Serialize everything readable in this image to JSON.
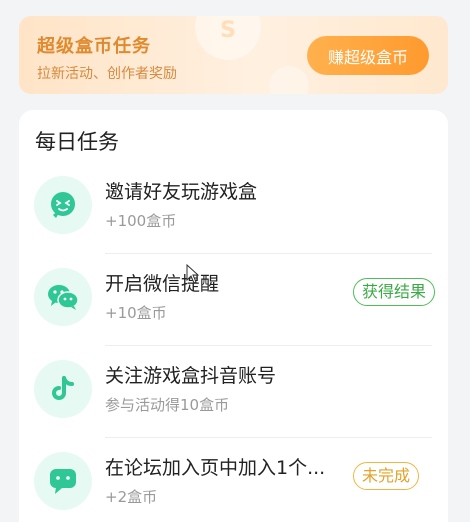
{
  "banner": {
    "title": "超级盒币任务",
    "subtitle": "拉新活动、创作者奖励",
    "button_label": "赚超级盒币",
    "coin_glyph": "S"
  },
  "daily": {
    "title": "每日任务",
    "tasks": [
      {
        "name": "邀请好友玩游戏盒",
        "reward": "+100盒币",
        "status": "",
        "icon": "invite-face-icon"
      },
      {
        "name": "开启微信提醒",
        "reward": "+10盒币",
        "status": "获得结果",
        "icon": "wechat-icon"
      },
      {
        "name": "关注游戏盒抖音账号",
        "reward": "参与活动得10盒币",
        "status": "",
        "icon": "tiktok-icon"
      },
      {
        "name": "在论坛加入页中加入1个...",
        "reward": "+2盒币",
        "status": "未完成",
        "icon": "chat-bubble-icon"
      }
    ]
  },
  "colors": {
    "accent_green": "#2ec795",
    "done_green": "#4cbf57",
    "todo_orange": "#f2b640",
    "banner_orange": "#ff9a2e"
  }
}
